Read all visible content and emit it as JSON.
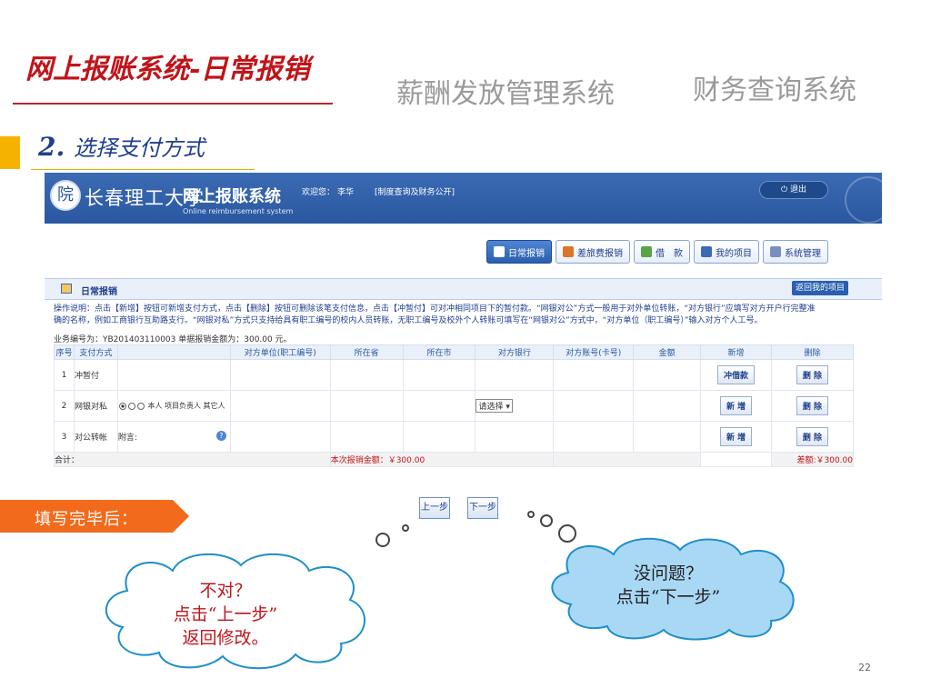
{
  "slide": {
    "title": "网上报账系统-日常报销",
    "nav_salary": "薪酬发放管理系统",
    "nav_finance": "财务查询系统",
    "step_number": "2.",
    "step_text": "选择支付方式",
    "callout": "填写完毕后：",
    "cloud_left": [
      "不对？",
      "点击“上一步”",
      "返回修改。"
    ],
    "cloud_right": [
      "没问题？",
      "点击“下一步”"
    ],
    "page_number": "22"
  },
  "app": {
    "univ_name": "长春理工大学",
    "system_name": "网上报账系统",
    "system_name_en": "Online reimbursement system",
    "welcome_label": "欢迎您：",
    "user": "李华",
    "policy_link": "[制度查询及财务公开]",
    "logout": "退出",
    "tabs": [
      "日常报销",
      "差旅费报销",
      "借　款",
      "我的项目",
      "系统管理"
    ],
    "section_title": "日常报销",
    "back_button": "返回我的项目",
    "instructions_1": "操作说明：点击【新增】按钮可新增支付方式，点击【删除】按钮可删除该笔支付信息，点击【冲暂付】可对冲相同项目下的暂付款。“网银对公”方式一般用于对外单位转账，“对方银行”应填写对方开户行完整准",
    "instructions_2": "确的名称，例如工商银行互助路支行。“网银对私”方式只支持给具有职工编号的校内人员转账，无职工编号及校外个人转账可填写在“网银对公”方式中，“对方单位（职工编号）”输入对方个人工号。",
    "doc_info": "业务编号为：YB201403110003  单据报销金额为：300.00 元。",
    "columns": [
      "序号",
      "支付方式",
      "对方单位(职工编号)",
      "所在省",
      "所在市",
      "对方银行",
      "对方账号(卡号)",
      "金额",
      "新增",
      "删除"
    ],
    "rows": [
      {
        "no": "1",
        "method": "冲暂付",
        "extra": "",
        "select": "",
        "add": "冲借款",
        "del": "删 除"
      },
      {
        "no": "2",
        "method": "网银对私",
        "extra": "本人 项目负责人 其它人",
        "select": "请选择",
        "add": "新 增",
        "del": "删 除"
      },
      {
        "no": "3",
        "method": "对公转帐",
        "extra": "附言:",
        "select": "",
        "add": "新 增",
        "del": "删 除"
      }
    ],
    "total_label": "合计：",
    "total_amount": "本次报销金额：￥300.00",
    "diff_amount": "差额:￥300.00",
    "prev_button": "上一步",
    "next_button": "下一步"
  },
  "colors": {
    "title_red": "#c0141a",
    "accent_blue": "#1f3e8c",
    "header_blue": "#2a57a0",
    "callout_orange": "#f26a1b",
    "cloud_blue": "#a9d8f5"
  }
}
